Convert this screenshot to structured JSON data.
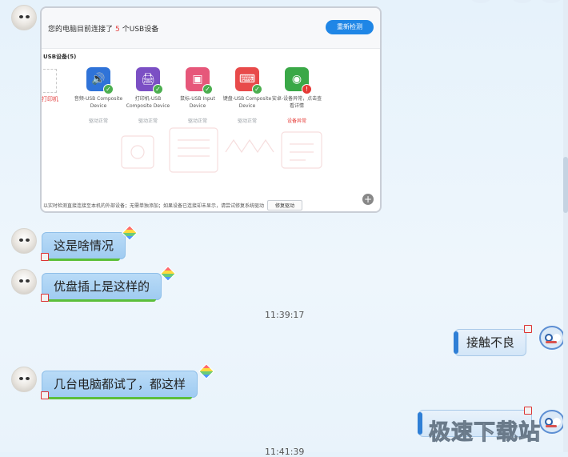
{
  "screenshot": {
    "title_prefix": "您的电脑目前连接了",
    "device_count": "5",
    "title_suffix": "个USB设备",
    "recheck_label": "重新检测",
    "section_label": "USB设备(5)",
    "partial_device_label": "打印机",
    "devices": [
      {
        "name": "音频-USB Composite Device",
        "status": "驱动正常",
        "color": "#2f73d8",
        "glyph": "🔊",
        "error": false
      },
      {
        "name": "打印机-USB Composite Device",
        "status": "驱动正常",
        "color": "#7b4fc4",
        "glyph": "🖨",
        "error": false
      },
      {
        "name": "鼠标-USB Input Device",
        "status": "驱动正常",
        "color": "#e6577a",
        "glyph": "▣",
        "error": false
      },
      {
        "name": "键盘-USB Composite Device",
        "status": "驱动正常",
        "color": "#e84a4a",
        "glyph": "⌨",
        "error": false
      },
      {
        "name": "安卓-设备异常，点击查看详情",
        "status": "设备异常",
        "color": "#3aa847",
        "glyph": "◉",
        "error": true
      }
    ],
    "footer_text": "以实时检测直接连接至本机的外部设备；无需单独添加；如果设备已连接却未显示，请尝试修复系统驱动",
    "repair_label": "修复驱动",
    "plus": "+"
  },
  "messages": [
    {
      "side": "left",
      "text": "这是啥情况"
    },
    {
      "side": "left",
      "text": "优盘插上是这样的"
    },
    {
      "side": "right",
      "text": "接触不良"
    },
    {
      "side": "left",
      "text": "几台电脑都试了，都这样"
    },
    {
      "side": "right",
      "text": ""
    }
  ],
  "timestamps": [
    "11:39:17",
    "11:41:39"
  ],
  "watermark": "极速下载站"
}
